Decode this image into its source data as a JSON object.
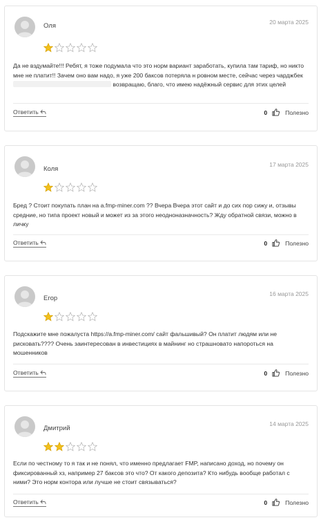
{
  "reviews": [
    {
      "author": "Оля",
      "date": "20 марта 2025",
      "rating": 1,
      "text_before": "Да не вздумайте!!! Ребят, я тоже подумала что это норм вариант заработать, купила там тариф, но никто мне не платит!! Зачем оно вам надо, я уже 200 баксов потеряла н ровном месте, сейчас через чарджбек",
      "text_after": "возвращаю, благо, что имею надёжный сервис для этих целей",
      "reply_label": "Ответить",
      "likes": "0",
      "useful_label": "Полезно"
    },
    {
      "author": "Коля",
      "date": "17 марта 2025",
      "rating": 1,
      "text": "Бред ? Стоит покупать план на a.fmp-miner.com ?? Вчера Вчера этот сайт и до сих пор сижу и, отзывы средние, но типа проект новый и может из за этого неодноназначность? Жду обратной связи, можно в личку",
      "reply_label": "Ответить",
      "likes": "0",
      "useful_label": "Полезно"
    },
    {
      "author": "Егор",
      "date": "16 марта 2025",
      "rating": 1,
      "text": "Подскажите мне пожалуста https://a.fmp-miner.com/ сайт фальшивый? Он платит людям или не рисковать???? Очень заинтересован в инвестициях в майнинг но страшновато напороться на мошенников",
      "reply_label": "Ответить",
      "likes": "0",
      "useful_label": "Полезно"
    },
    {
      "author": "Дмитрий",
      "date": "14 марта 2025",
      "rating": 2,
      "text": "Если по честному то я так и не понял, что именно предлагает FMP, написано доход, но почему он фиксированный хз, например 27 баксов это что? От какого депозита? Кто нибудь вообще работал с ними? Это норм контора или лучше не стоит связываться?",
      "reply_label": "Ответить",
      "likes": "0",
      "useful_label": "Полезно"
    }
  ],
  "colors": {
    "star_filled": "#f2c01c",
    "star_outline": "#b9b9b9",
    "avatar_bg": "#c9c9c9"
  },
  "icons": {
    "avatar": "user-silhouette-icon",
    "star": "star-icon",
    "reply": "reply-arrow-icon",
    "like": "thumbs-up-icon"
  }
}
